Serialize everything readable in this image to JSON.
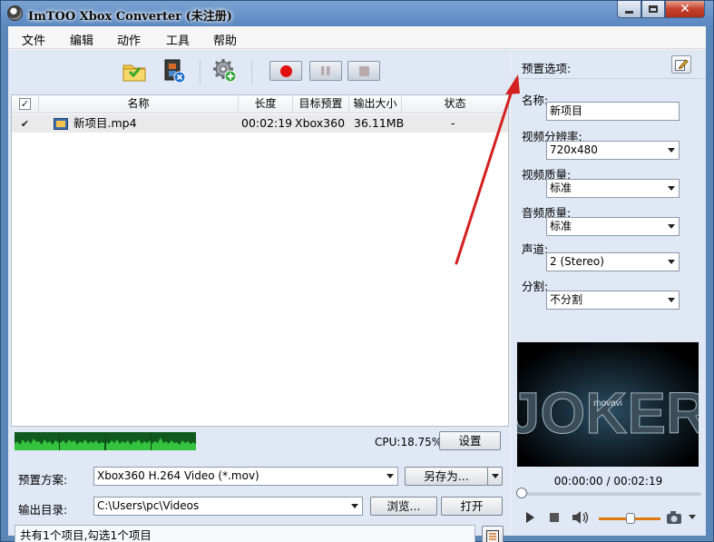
{
  "window": {
    "title": "ImTOO Xbox Converter (未注册)"
  },
  "menu": [
    "文件",
    "编辑",
    "动作",
    "工具",
    "帮助"
  ],
  "list": {
    "columns": [
      "名称",
      "长度",
      "目标预置",
      "输出大小",
      "状态"
    ],
    "rows": [
      {
        "checked": true,
        "name": "新项目.mp4",
        "length": "00:02:19",
        "target": "Xbox360",
        "size": "36.11MB",
        "status": "-"
      }
    ]
  },
  "cpu": {
    "label": "CPU:18.75%"
  },
  "buttons": {
    "settings": "设置",
    "save_as": "另存为...",
    "browse": "浏览...",
    "open": "打开"
  },
  "preset_profile": {
    "label": "预置方案:",
    "value": "Xbox360 H.264 Video (*.mov)"
  },
  "output_dir": {
    "label": "输出目录:",
    "value": "C:\\Users\\pc\\Videos"
  },
  "status": {
    "text": "共有1个项目,勾选1个项目"
  },
  "preset_options": {
    "title": "预置选项:",
    "name_label": "名称:",
    "name_value": "新项目",
    "video_resolution_label": "视频分辨率:",
    "video_resolution_value": "720x480",
    "video_quality_label": "视频质量:",
    "video_quality_value": "标准",
    "audio_quality_label": "音频质量:",
    "audio_quality_value": "标准",
    "channels_label": "声道:",
    "channels_value": "2 (Stereo)",
    "split_label": "分割:",
    "split_value": "不分割"
  },
  "preview": {
    "movie_text": "JOKER",
    "logo_text": "movavi",
    "time": "00:00:00 / 00:02:19",
    "seek_position": 0,
    "volume_level": 0.5
  },
  "colors": {
    "accent_blue": "#5b86b8",
    "record_red": "#e01010",
    "panel_bg": "#dfe8f4",
    "cpu_green": "#2fbf3f",
    "annotation_red": "#d42020"
  }
}
